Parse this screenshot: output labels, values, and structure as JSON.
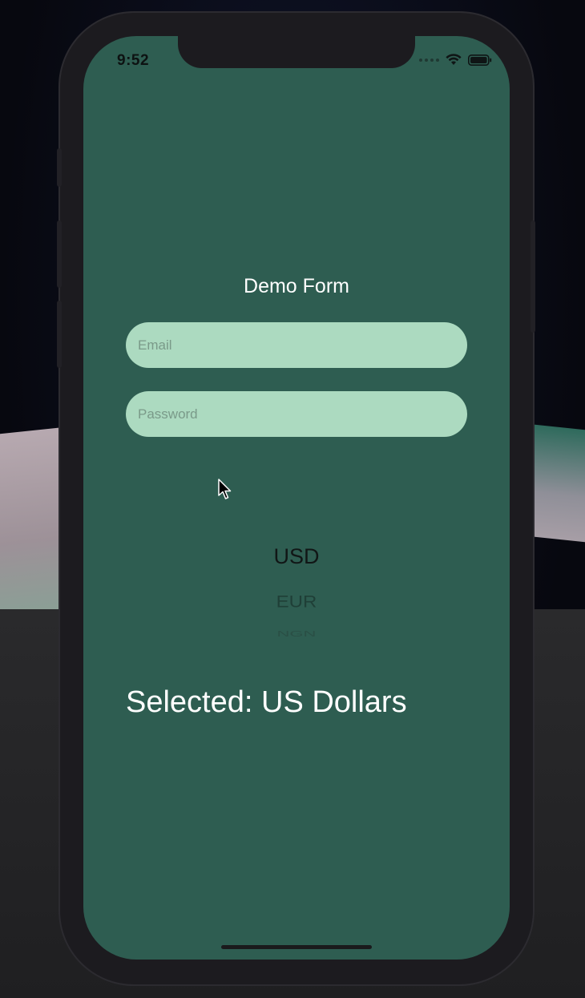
{
  "status_bar": {
    "time": "9:52",
    "icons": [
      "signal-dots-icon",
      "wifi-icon",
      "battery-icon"
    ]
  },
  "form": {
    "title": "Demo Form",
    "email_placeholder": "Email",
    "password_placeholder": "Password"
  },
  "picker": {
    "options": [
      "USD",
      "EUR",
      "NGN"
    ],
    "selected_index": 0
  },
  "selected_label": "Selected: US Dollars",
  "colors": {
    "screen_background": "#2e5d51",
    "input_background": "#acdac0",
    "text_light": "#ffffff"
  }
}
